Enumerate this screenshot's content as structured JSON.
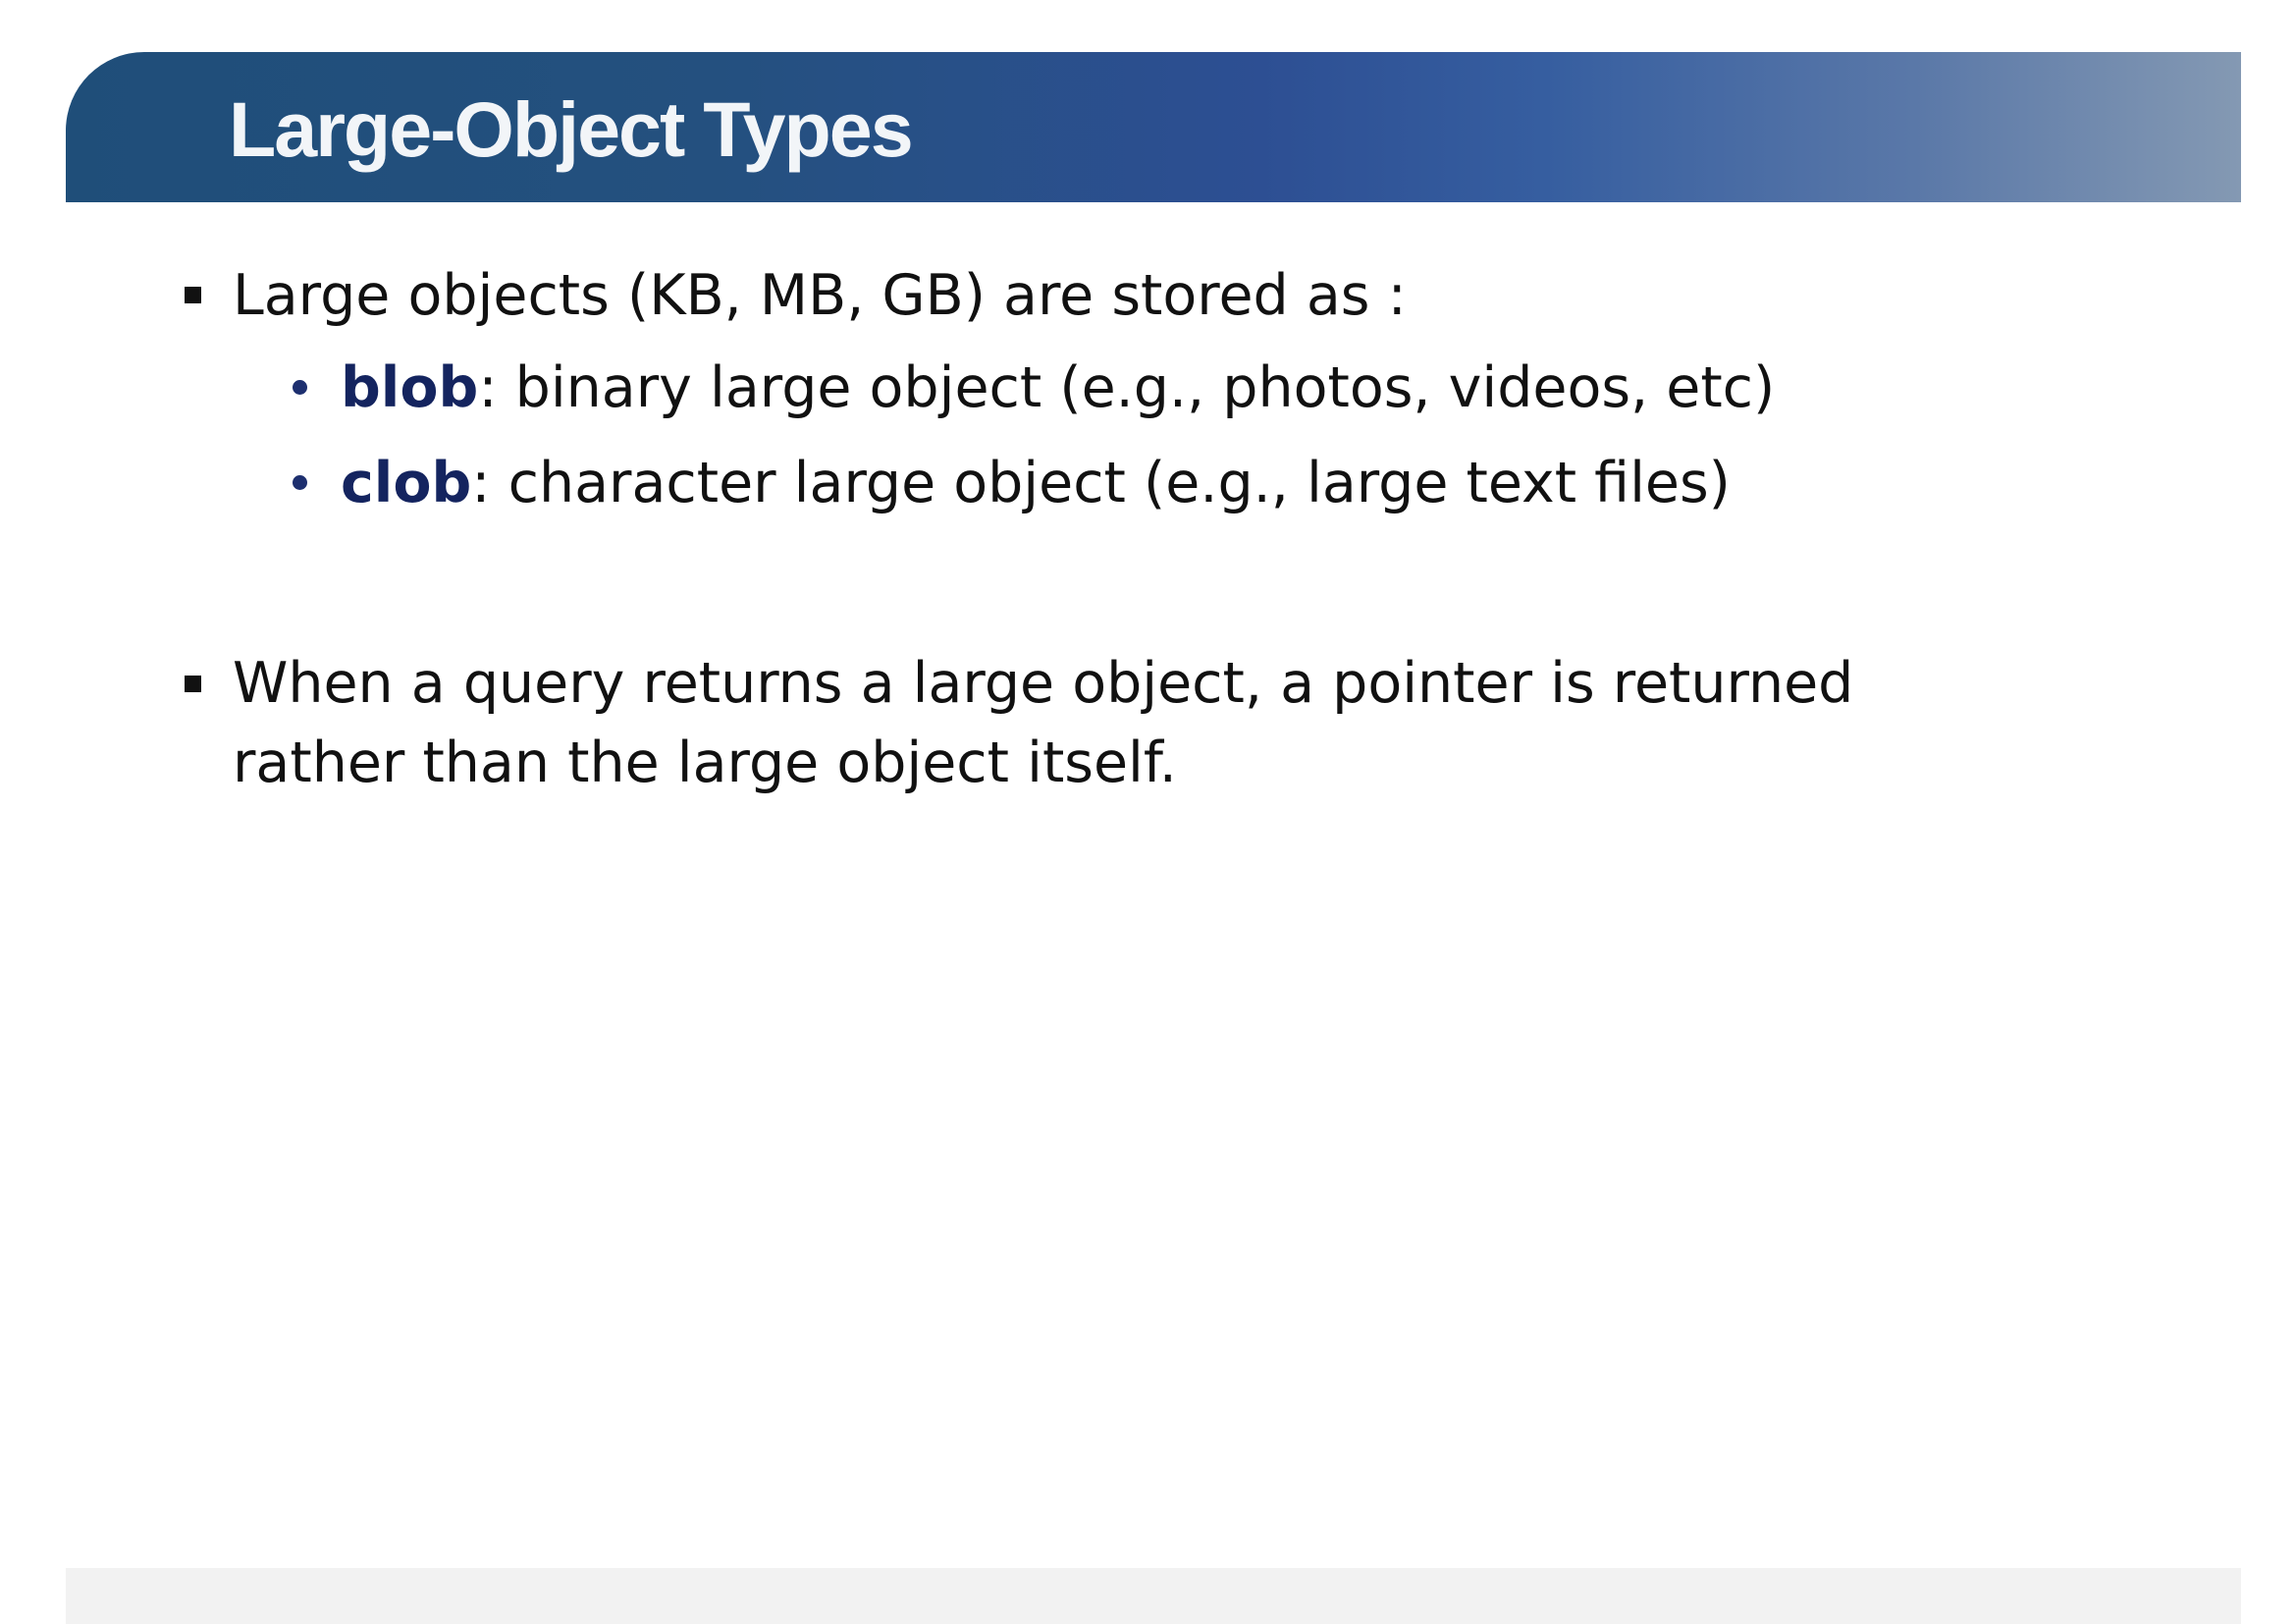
{
  "slide": {
    "title": "Large-Object Types",
    "bullet1": {
      "text": "Large objects (KB, MB, GB) are stored as :",
      "sub": [
        {
          "term": "blob",
          "rest": ": binary large object (e.g., photos, videos, etc)"
        },
        {
          "term": "clob",
          "rest": ": character large object (e.g., large text files)"
        }
      ]
    },
    "bullet2": {
      "line1": "When a query returns a large object, a pointer is returned",
      "line2": "rather than the large object itself."
    }
  },
  "colors": {
    "title_bar_start": "#1f4e79",
    "title_bar_end": "#8499b3",
    "term_color": "#14245f",
    "footer": "#f2f2f2"
  }
}
